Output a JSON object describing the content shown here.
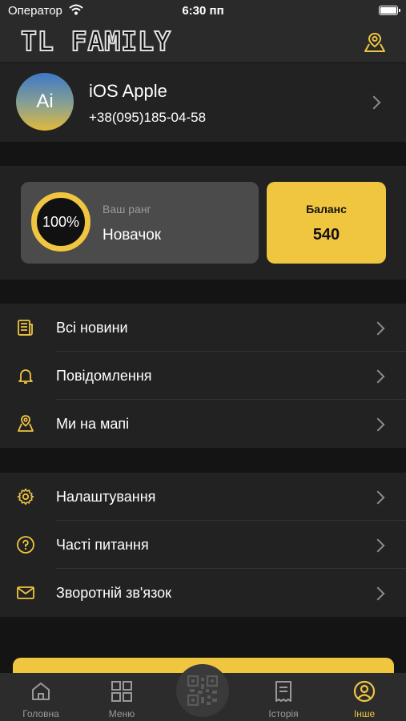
{
  "status": {
    "carrier": "Оператор",
    "time": "6:30 пп"
  },
  "header": {
    "logo": "TL FAMILY",
    "map_icon": "map-pin-icon"
  },
  "profile": {
    "initials": "Ai",
    "name": "iOS Apple",
    "phone": "+38(095)185-04-58"
  },
  "rank": {
    "percent": "100%",
    "label": "Ваш ранг",
    "value": "Новачок"
  },
  "balance": {
    "label": "Баланс",
    "value": "540"
  },
  "menu1": [
    {
      "label": "Всі новини",
      "icon": "news-icon"
    },
    {
      "label": "Повідомлення",
      "icon": "bell-icon"
    },
    {
      "label": "Ми на мапі",
      "icon": "map-pin-icon"
    }
  ],
  "menu2": [
    {
      "label": "Налаштування",
      "icon": "gear-icon"
    },
    {
      "label": "Часті питання",
      "icon": "question-icon"
    },
    {
      "label": "Зворотній зв'язок",
      "icon": "mail-icon"
    }
  ],
  "tabs": [
    {
      "label": "Головна",
      "icon": "home-icon"
    },
    {
      "label": "Меню",
      "icon": "grid-icon"
    },
    {
      "label": "",
      "icon": "qr-code-icon"
    },
    {
      "label": "Історія",
      "icon": "receipt-icon"
    },
    {
      "label": "Інше",
      "icon": "profile-icon",
      "active": true
    }
  ],
  "colors": {
    "accent": "#f0c540",
    "background": "#141414",
    "surface": "#222222"
  }
}
